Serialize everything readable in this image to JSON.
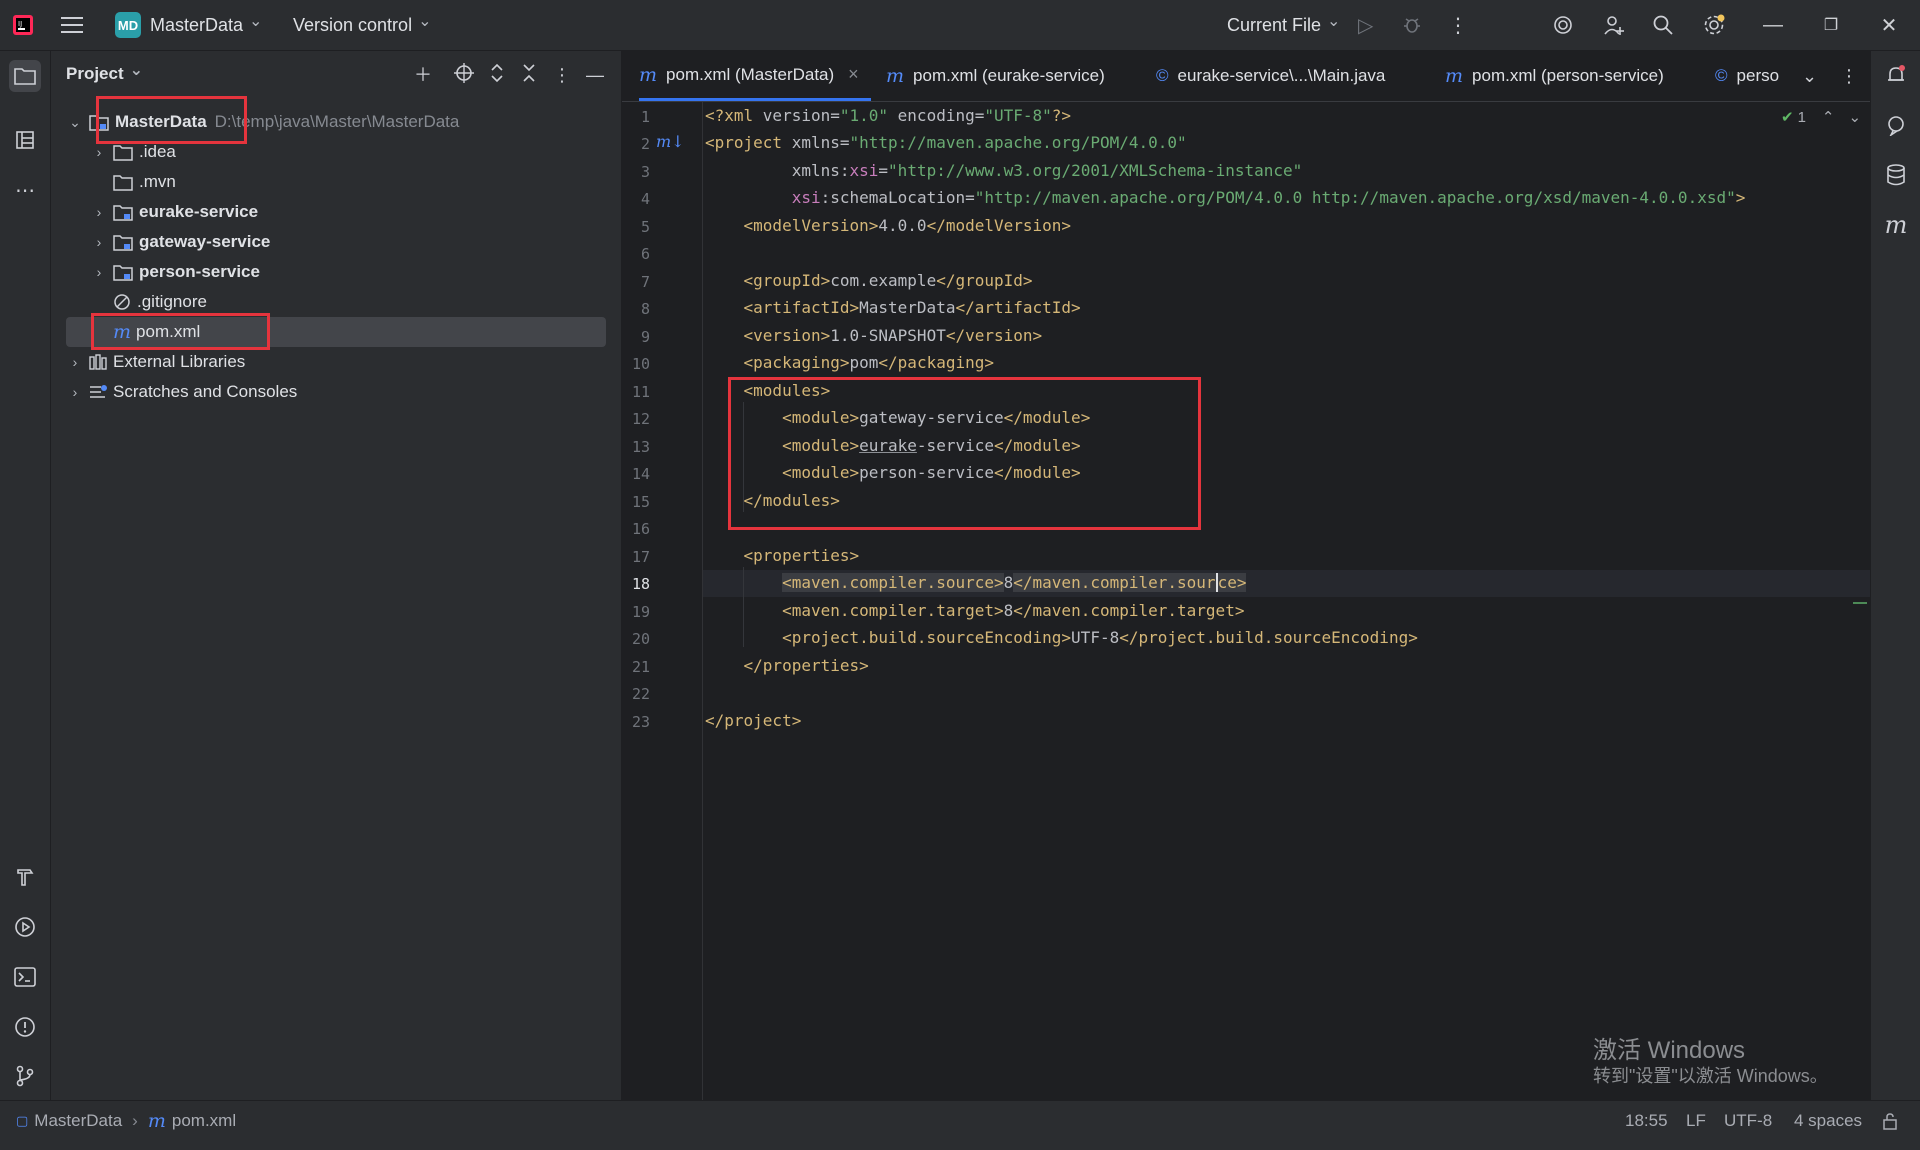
{
  "titlebar": {
    "project_badge": "MD",
    "project_name": "MasterData",
    "version_control": "Version control",
    "run_config": "Current File"
  },
  "project_panel": {
    "title": "Project",
    "tree": [
      {
        "label": "MasterData",
        "path": "D:\\temp\\java\\Master\\MasterData"
      },
      {
        "label": ".idea"
      },
      {
        "label": ".mvn"
      },
      {
        "label": "eurake-service"
      },
      {
        "label": "gateway-service"
      },
      {
        "label": "person-service"
      },
      {
        "label": ".gitignore"
      },
      {
        "label": "pom.xml"
      },
      {
        "label": "External Libraries"
      },
      {
        "label": "Scratches and Consoles"
      }
    ]
  },
  "tabs": [
    {
      "label": "pom.xml (MasterData)",
      "close": "×"
    },
    {
      "label": "pom.xml (eurake-service)"
    },
    {
      "label": "eurake-service\\...\\Main.java"
    },
    {
      "label": "pom.xml (person-service)"
    },
    {
      "label": "perso"
    }
  ],
  "editor": {
    "inspection_count": "1",
    "line_numbers": [
      "1",
      "2",
      "3",
      "4",
      "5",
      "6",
      "7",
      "8",
      "9",
      "10",
      "11",
      "12",
      "13",
      "14",
      "15",
      "16",
      "17",
      "18",
      "19",
      "20",
      "21",
      "22",
      "23"
    ],
    "current_line": "18"
  },
  "statusbar": {
    "breadcrumb_project": "MasterData",
    "breadcrumb_file": "pom.xml",
    "position": "18:55",
    "line_sep": "LF",
    "encoding": "UTF-8",
    "indent": "4 spaces"
  },
  "watermark": {
    "line1": "激活 Windows",
    "line2": "转到\"设置\"以激活 Windows。"
  }
}
